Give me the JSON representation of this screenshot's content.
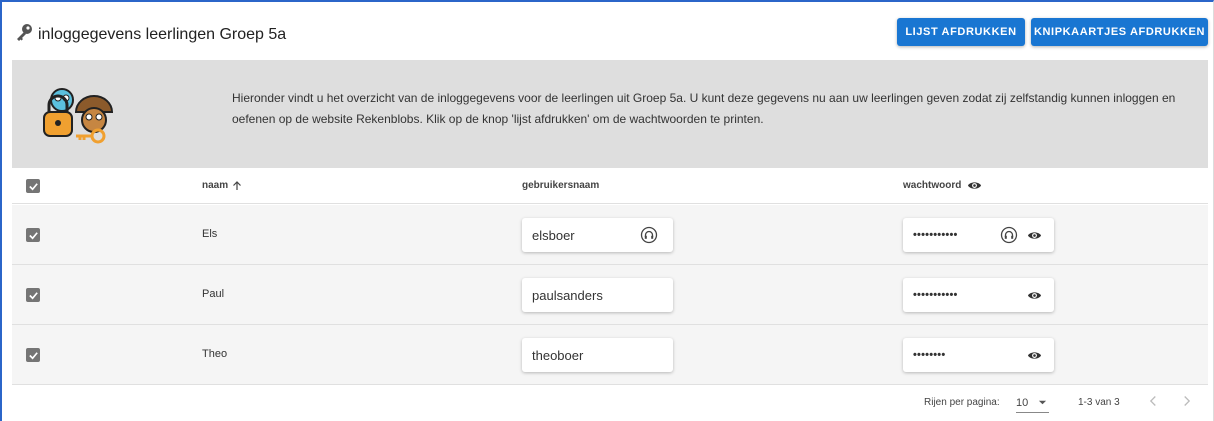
{
  "header": {
    "title": "inloggegevens leerlingen Groep 5a",
    "print_list_label": "LIJST AFDRUKKEN",
    "print_cards_label": "KNIPKAARTJES AFDRUKKEN"
  },
  "intro": {
    "text": "Hieronder vindt u het overzicht van de inloggegevens voor de leerlingen uit Groep 5a. U kunt deze gegevens nu aan uw leerlingen geven zodat zij zelfstandig kunnen inloggen en oefenen op de website Rekenblobs. Klik op de knop 'lijst afdrukken' om de wachtwoorden te printen."
  },
  "table": {
    "columns": {
      "name": "naam",
      "username": "gebruikersnaam",
      "password": "wachtwoord"
    },
    "rows": [
      {
        "name": "Els",
        "username": "elsboer",
        "password": "•••••••••••"
      },
      {
        "name": "Paul",
        "username": "paulsanders",
        "password": "•••••••••••"
      },
      {
        "name": "Theo",
        "username": "theoboer",
        "password": "••••••••"
      }
    ]
  },
  "pagination": {
    "rows_per_page_label": "Rijen per pagina:",
    "rows_per_page_value": "10",
    "range_text": "1-3 van 3"
  },
  "colors": {
    "primary": "#1976d2",
    "panel_bg": "#dedede",
    "checkbox": "#757575"
  }
}
